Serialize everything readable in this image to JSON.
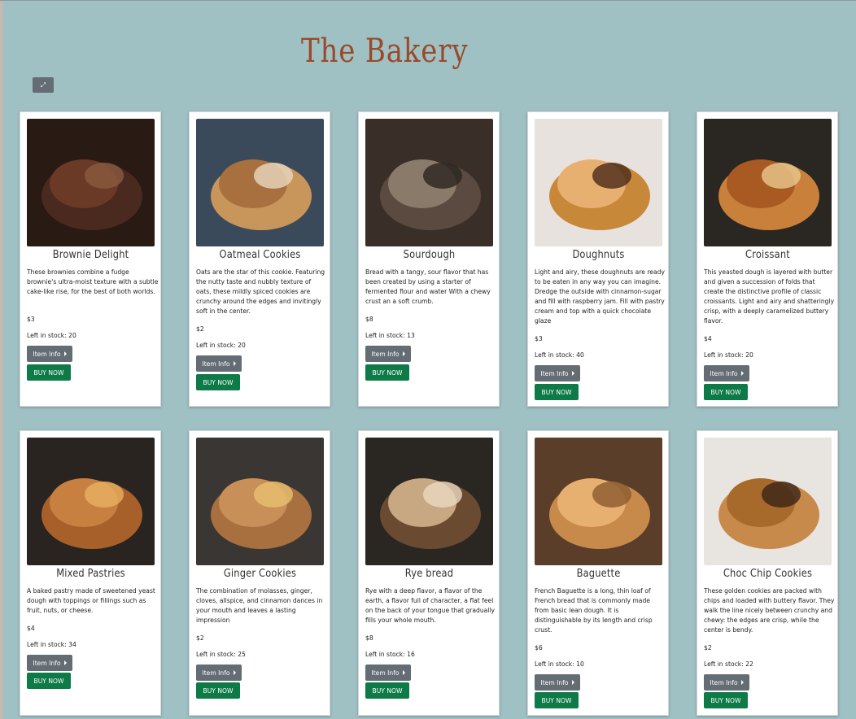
{
  "page": {
    "title": "The Bakery"
  },
  "toolbar": {
    "toggle_icon": "expand-icon"
  },
  "products": [
    {
      "name": "Brownie Delight",
      "description": "These brownies combine a fudge brownie's ultra-moist texture with a subtle cake-like rise, for the best of both worlds.",
      "price": "$3",
      "stock": "Left in stock: 20",
      "info_label": "Item Info",
      "buy_label": "BUY NOW",
      "image_icon": "brownie-image"
    },
    {
      "name": "Oatmeal Cookies",
      "description": "Oats are the star of this cookie. Featuring the nutty taste and nubbly texture of oats, these mildly spiced cookies are crunchy around the edges and invitingly soft in the center.",
      "price": "$2",
      "stock": "Left in stock: 20",
      "info_label": "Item Info",
      "buy_label": "BUY NOW",
      "image_icon": "cookies-image"
    },
    {
      "name": "Sourdough",
      "description": "Bread with a tangy, sour flavor that has been created by using a starter of fermented flour and water With a chewy crust an a soft crumb.",
      "price": "$8",
      "stock": "Left in stock: 13",
      "info_label": "Item Info",
      "buy_label": "BUY NOW",
      "image_icon": "bread-image"
    },
    {
      "name": "Doughnuts",
      "description": "Light and airy, these doughnuts are ready to be eaten in any way you can imagine. Dredge the outside with cinnamon-sugar and fill with raspberry jam. Fill with pastry cream and top with a quick chocolate glaze",
      "price": "$3",
      "stock": "Left in stock: 40",
      "info_label": "Item Info",
      "buy_label": "BUY NOW",
      "image_icon": "doughnuts-image"
    },
    {
      "name": "Croissant",
      "description": "This yeasted dough is layered with butter and given a succession of folds that create the distinctive profile of classic croissants. Light and airy and shatteringly crisp, with a deeply caramelized buttery flavor.",
      "price": "$4",
      "stock": "Left in stock: 20",
      "info_label": "Item Info",
      "buy_label": "BUY NOW",
      "image_icon": "croissant-image"
    },
    {
      "name": "Mixed Pastries",
      "description": "A baked pastry made of sweetened yeast dough with toppings or fillings such as fruit, nuts, or cheese.",
      "price": "$4",
      "stock": "Left in stock: 34",
      "info_label": "Item Info",
      "buy_label": "BUY NOW",
      "image_icon": "pastries-image"
    },
    {
      "name": "Ginger Cookies",
      "description": "The combination of molasses, ginger, cloves, allspice, and cinnamon dances in your mouth and leaves a lasting impression",
      "price": "$2",
      "stock": "Left in stock: 25",
      "info_label": "Item Info",
      "buy_label": "BUY NOW",
      "image_icon": "ginger-cookies-image"
    },
    {
      "name": "Rye bread",
      "description": "Rye with a deep flavor, a flavor of the earth, a flavor full of character, a flat feel on the back of your tongue that gradually fills your whole mouth.",
      "price": "$8",
      "stock": "Left in stock: 16",
      "info_label": "Item Info",
      "buy_label": "BUY NOW",
      "image_icon": "rye-bread-image"
    },
    {
      "name": "Baguette",
      "description": "French Baguette is a long, thin loaf of French bread that is commonly made from basic lean dough. It is distinguishable by its length and crisp crust.",
      "price": "$6",
      "stock": "Left in stock: 10",
      "info_label": "Item Info",
      "buy_label": "BUY NOW",
      "image_icon": "baguette-image"
    },
    {
      "name": "Choc Chip Cookies",
      "description": "These golden cookies are packed with chips and loaded with buttery flavor. They walk the line nicely between crunchy and chewy: the edges are crisp, while the center is bendy.",
      "price": "$2",
      "stock": "Left in stock: 22",
      "info_label": "Item Info",
      "buy_label": "BUY NOW",
      "image_icon": "choc-chip-cookies-image"
    }
  ]
}
